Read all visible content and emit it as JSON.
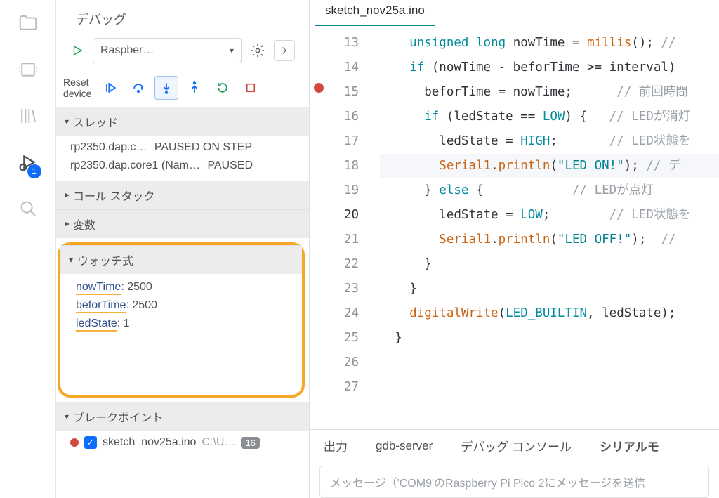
{
  "activity_bar": {
    "debug_badge": "1"
  },
  "panel": {
    "title": "デバッグ",
    "config_selected": "Raspber…",
    "reset_label": "Reset\ndevice",
    "sections": {
      "threads": {
        "label": "スレッド",
        "rows": [
          {
            "name": "rp2350.dap.c…",
            "status": "PAUSED ON STEP"
          },
          {
            "name": "rp2350.dap.core1 (Nam…",
            "status": "PAUSED"
          }
        ]
      },
      "callstack": {
        "label": "コール スタック"
      },
      "variables": {
        "label": "変数"
      },
      "watch": {
        "label": "ウォッチ式",
        "items": [
          {
            "name": "nowTime",
            "value": "2500"
          },
          {
            "name": "beforTime",
            "value": "2500"
          },
          {
            "name": "ledState",
            "value": "1"
          }
        ]
      },
      "breakpoints": {
        "label": "ブレークポイント",
        "items": [
          {
            "file": "sketch_nov25a.ino",
            "path_hint": "C:\\U…",
            "line": "16"
          }
        ]
      }
    }
  },
  "editor": {
    "tab_label": "sketch_nov25a.ino",
    "lines": [
      {
        "n": "13",
        "indent": 2,
        "tokens": [
          [
            "kw",
            "unsigned"
          ],
          [
            "text",
            " "
          ],
          [
            "kw",
            "long"
          ],
          [
            "text",
            " nowTime = "
          ],
          [
            "fn",
            "millis"
          ],
          [
            "text",
            "(); "
          ],
          [
            "cmt",
            "//"
          ]
        ]
      },
      {
        "n": "14",
        "indent": 0,
        "tokens": []
      },
      {
        "n": "15",
        "indent": 2,
        "tokens": [
          [
            "kw",
            "if"
          ],
          [
            "text",
            " (nowTime - beforTime >= interval)"
          ]
        ]
      },
      {
        "n": "16",
        "bp": true,
        "indent": 3,
        "tokens": [
          [
            "text",
            "beforTime = nowTime;      "
          ],
          [
            "cmt",
            "// 前回時間"
          ]
        ]
      },
      {
        "n": "17",
        "indent": 0,
        "tokens": []
      },
      {
        "n": "18",
        "indent": 3,
        "tokens": [
          [
            "kw",
            "if"
          ],
          [
            "text",
            " (ledState == "
          ],
          [
            "const",
            "LOW"
          ],
          [
            "text",
            ") {   "
          ],
          [
            "cmt",
            "// LEDが消灯"
          ]
        ]
      },
      {
        "n": "19",
        "indent": 4,
        "tokens": [
          [
            "text",
            "ledState = "
          ],
          [
            "const",
            "HIGH"
          ],
          [
            "text",
            ";       "
          ],
          [
            "cmt",
            "// LED状態を"
          ]
        ]
      },
      {
        "n": "20",
        "current": true,
        "indent": 4,
        "tokens": [
          [
            "fn",
            "Serial1"
          ],
          [
            "text",
            "."
          ],
          [
            "fn",
            "println"
          ],
          [
            "text",
            "("
          ],
          [
            "str",
            "\"LED ON!\""
          ],
          [
            "text",
            "); "
          ],
          [
            "cmt",
            "// デ"
          ]
        ]
      },
      {
        "n": "21",
        "indent": 3,
        "tokens": [
          [
            "text",
            "} "
          ],
          [
            "kw",
            "else"
          ],
          [
            "text",
            " {            "
          ],
          [
            "cmt",
            "// LEDが点灯"
          ]
        ]
      },
      {
        "n": "22",
        "indent": 4,
        "tokens": [
          [
            "text",
            "ledState = "
          ],
          [
            "const",
            "LOW"
          ],
          [
            "text",
            ";        "
          ],
          [
            "cmt",
            "// LED状態を"
          ]
        ]
      },
      {
        "n": "23",
        "indent": 4,
        "tokens": [
          [
            "fn",
            "Serial1"
          ],
          [
            "text",
            "."
          ],
          [
            "fn",
            "println"
          ],
          [
            "text",
            "("
          ],
          [
            "str",
            "\"LED OFF!\""
          ],
          [
            "text",
            ");  "
          ],
          [
            "cmt",
            "//"
          ]
        ]
      },
      {
        "n": "24",
        "indent": 3,
        "tokens": [
          [
            "text",
            "}"
          ]
        ]
      },
      {
        "n": "25",
        "indent": 2,
        "tokens": [
          [
            "text",
            "}"
          ]
        ]
      },
      {
        "n": "26",
        "indent": 2,
        "tokens": [
          [
            "fn",
            "digitalWrite"
          ],
          [
            "text",
            "("
          ],
          [
            "const",
            "LED_BUILTIN"
          ],
          [
            "text",
            ", ledState);"
          ]
        ]
      },
      {
        "n": "27",
        "indent": 1,
        "tokens": [
          [
            "text",
            "}"
          ]
        ]
      }
    ]
  },
  "bottom": {
    "tabs": [
      "出力",
      "gdb-server",
      "デバッグ コンソール",
      "シリアルモ"
    ],
    "serial_placeholder": "メッセージ（'COM9'のRaspberry Pi Pico 2にメッセージを送信"
  }
}
